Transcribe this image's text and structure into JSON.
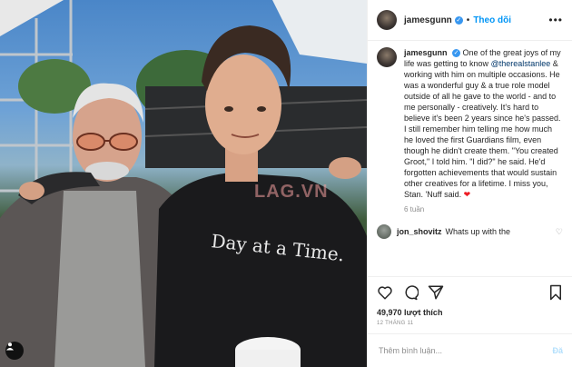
{
  "header": {
    "username": "jamesgunn",
    "follow_label": "Theo dõi",
    "more_icon": "more-horizontal-icon"
  },
  "caption": {
    "username": "jamesgunn",
    "part1": "One of the great joys of my life was getting to know ",
    "mention": "@therealstanlee",
    "part2": " & working with him on multiple occasions. He was a wonderful guy & a true role model outside of all he gave to the world - and to me personally - creatively. It's hard to believe it's been 2 years since he's passed. I still remember him telling me how much he loved the first Guardians film, even though he didn't create them. \"You created Groot,\" I told him. \"I did?\" he said. He'd forgotten achievements that would sustain other creatives for a lifetime. I miss you, Stan. 'Nuff said. ",
    "emoji": "❤",
    "time": "6 tuần"
  },
  "comment": {
    "username": "jon_shovitz",
    "text": "Whats up with the"
  },
  "actions": {
    "likes": "49,970 lượt thích",
    "date": "12 THÁNG 11"
  },
  "composer": {
    "placeholder": "Thêm bình luận...",
    "post_label": "Đă"
  },
  "photo": {
    "watermark": "LAG.VN",
    "shirt_text": "Day at a Time."
  },
  "colors": {
    "link": "#00376b",
    "follow": "#0095f6",
    "verified": "#3897f0",
    "heart": "#ed1c24"
  }
}
